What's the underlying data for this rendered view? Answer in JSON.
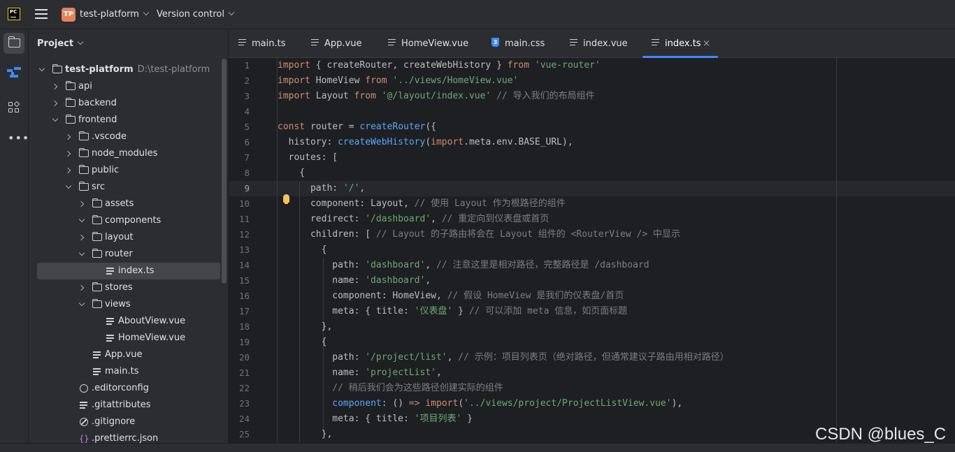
{
  "titlebar": {
    "app_logo_text": "PC",
    "project_badge": "TP",
    "project_name": "test-platform",
    "version_control": "Version control"
  },
  "project_panel": {
    "title": "Project",
    "tree": [
      {
        "label": "test-platform",
        "path": "D:\\test-platform",
        "type": "root"
      },
      {
        "label": "api",
        "type": "folder"
      },
      {
        "label": "backend",
        "type": "folder"
      },
      {
        "label": "frontend",
        "type": "folder"
      },
      {
        "label": ".vscode",
        "type": "folder"
      },
      {
        "label": "node_modules",
        "type": "folder"
      },
      {
        "label": "public",
        "type": "folder"
      },
      {
        "label": "src",
        "type": "folder"
      },
      {
        "label": "assets",
        "type": "folder"
      },
      {
        "label": "components",
        "type": "folder"
      },
      {
        "label": "layout",
        "type": "folder"
      },
      {
        "label": "router",
        "type": "folder"
      },
      {
        "label": "index.ts",
        "type": "file"
      },
      {
        "label": "stores",
        "type": "folder"
      },
      {
        "label": "views",
        "type": "folder"
      },
      {
        "label": "AboutView.vue",
        "type": "file"
      },
      {
        "label": "HomeView.vue",
        "type": "file"
      },
      {
        "label": "App.vue",
        "type": "file"
      },
      {
        "label": "main.ts",
        "type": "file"
      },
      {
        "label": ".editorconfig",
        "type": "config"
      },
      {
        "label": ".gitattributes",
        "type": "text"
      },
      {
        "label": ".gitignore",
        "type": "ignore"
      },
      {
        "label": ".prettierrc.json",
        "type": "json"
      }
    ]
  },
  "tabs": [
    {
      "label": "main.ts"
    },
    {
      "label": "App.vue"
    },
    {
      "label": "HomeView.vue"
    },
    {
      "label": "main.css"
    },
    {
      "label": "index.vue"
    },
    {
      "label": "index.ts",
      "active": true
    }
  ],
  "tab_close": "×",
  "editor": {
    "current_line": 9,
    "lines": [
      {
        "n": "1",
        "text": "import { createRouter, createWebHistory } from 'vue-router'"
      },
      {
        "n": "2",
        "text": "import HomeView from '../views/HomeView.vue'"
      },
      {
        "n": "3",
        "text": "import Layout from '@/layout/index.vue' // 导入我们的布局组件"
      },
      {
        "n": "4",
        "text": ""
      },
      {
        "n": "5",
        "text": "const router = createRouter({"
      },
      {
        "n": "6",
        "text": "  history: createWebHistory(import.meta.env.BASE_URL),"
      },
      {
        "n": "7",
        "text": "  routes: ["
      },
      {
        "n": "8",
        "text": "    {"
      },
      {
        "n": "9",
        "text": "      path: '/',"
      },
      {
        "n": "10",
        "text": "      component: Layout, // 使用 Layout 作为根路径的组件"
      },
      {
        "n": "11",
        "text": "      redirect: '/dashboard', // 重定向到仪表盘或首页"
      },
      {
        "n": "12",
        "text": "      children: [ // Layout 的子路由将会在 Layout 组件的 <RouterView /> 中显示"
      },
      {
        "n": "13",
        "text": "        {"
      },
      {
        "n": "14",
        "text": "          path: 'dashboard', // 注意这里是相对路径，完整路径是 /dashboard"
      },
      {
        "n": "15",
        "text": "          name: 'dashboard',"
      },
      {
        "n": "16",
        "text": "          component: HomeView, // 假设 HomeView 是我们的仪表盘/首页"
      },
      {
        "n": "17",
        "text": "          meta: { title: '仪表盘' } // 可以添加 meta 信息，如页面标题"
      },
      {
        "n": "18",
        "text": "        },"
      },
      {
        "n": "19",
        "text": "        {"
      },
      {
        "n": "20",
        "text": "          path: '/project/list', // 示例：项目列表页（绝对路径，但通常建议子路由用相对路径）"
      },
      {
        "n": "21",
        "text": "          name: 'projectList',"
      },
      {
        "n": "22",
        "text": "          // 稍后我们会为这些路径创建实际的组件"
      },
      {
        "n": "23",
        "text": "          component: () => import('../views/project/ProjectListView.vue'),"
      },
      {
        "n": "24",
        "text": "          meta: { title: '项目列表' }"
      },
      {
        "n": "25",
        "text": "        },"
      }
    ]
  },
  "watermark": "CSDN @blues_C",
  "colors": {
    "keyword": "#cf8e6d",
    "string": "#6aab73",
    "function": "#56a8f5",
    "comment": "#7a7e85",
    "accent": "#3d8af7"
  }
}
